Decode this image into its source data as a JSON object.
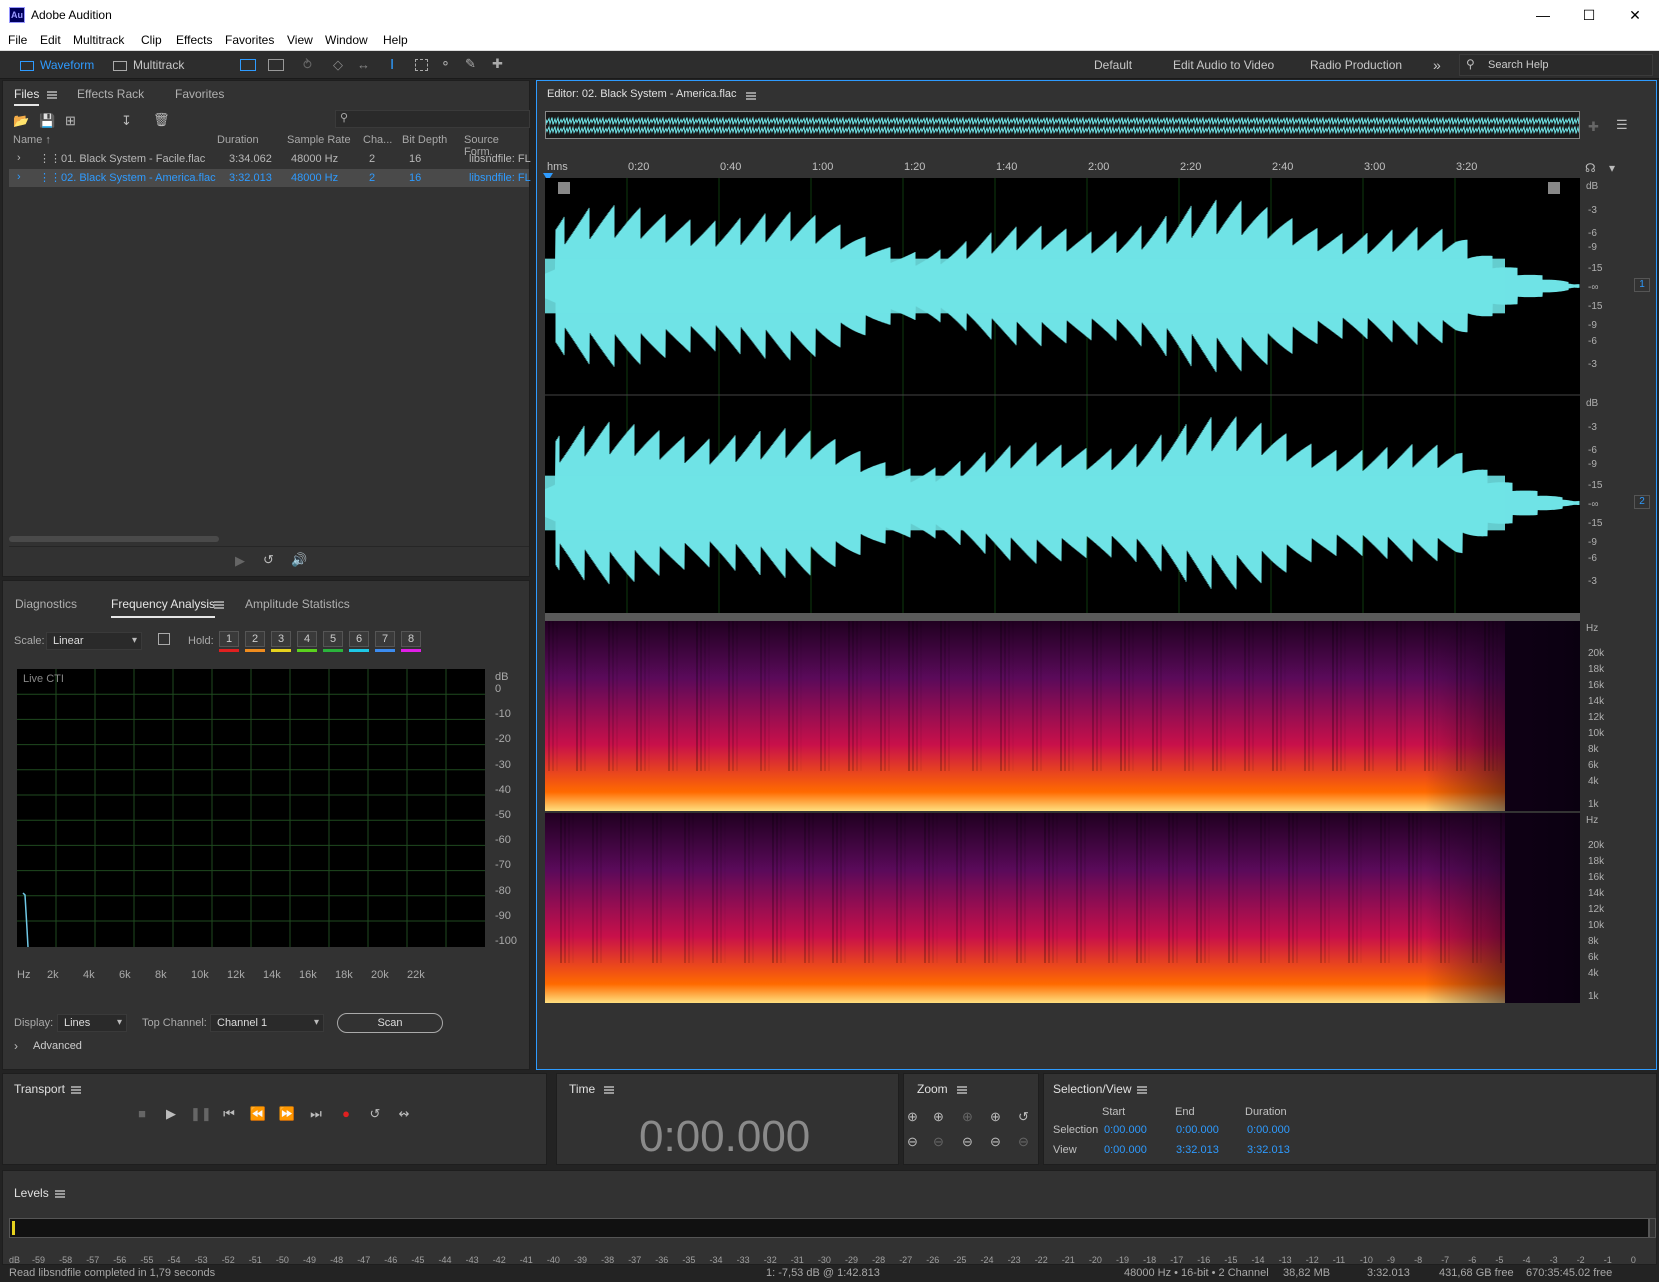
{
  "window": {
    "title": "Adobe Audition",
    "logo": "Au"
  },
  "menu": [
    "File",
    "Edit",
    "Multitrack",
    "Clip",
    "Effects",
    "Favorites",
    "View",
    "Window",
    "Help"
  ],
  "toolbar": {
    "waveform_label": "Waveform",
    "multitrack_label": "Multitrack",
    "workspaces": [
      "Default",
      "Edit Audio to Video",
      "Radio Production"
    ],
    "more": "»",
    "search_placeholder": "Search Help"
  },
  "files_panel": {
    "tabs": [
      "Files",
      "Effects Rack",
      "Favorites"
    ],
    "columns": [
      "Name ↑",
      "Duration",
      "Sample Rate",
      "Cha...",
      "Bit Depth",
      "Source Form."
    ],
    "rows": [
      {
        "name": "01. Black System - Facile.flac",
        "duration": "3:34.062",
        "rate": "48000 Hz",
        "ch": "2",
        "bits": "16",
        "src": "libsndfile: FL",
        "selected": false
      },
      {
        "name": "02. Black System - America.flac",
        "duration": "3:32.013",
        "rate": "48000 Hz",
        "ch": "2",
        "bits": "16",
        "src": "libsndfile: FL",
        "selected": true
      }
    ]
  },
  "freq_panel": {
    "tabs": [
      "Diagnostics",
      "Frequency Analysis",
      "Amplitude Statistics"
    ],
    "scale_label": "Scale:",
    "scale_value": "Linear",
    "hold_label": "Hold:",
    "hold_buttons": [
      "1",
      "2",
      "3",
      "4",
      "5",
      "6",
      "7",
      "8"
    ],
    "hold_colors": [
      "#e02020",
      "#f08c1e",
      "#e6d21e",
      "#5ad21e",
      "#2ab43c",
      "#1ec8e6",
      "#3c8cf0",
      "#e01ee6"
    ],
    "live_label": "Live CTI",
    "db_axis": [
      "dB",
      "0",
      "-10",
      "-20",
      "-30",
      "-40",
      "-50",
      "-60",
      "-70",
      "-80",
      "-90",
      "-100"
    ],
    "hz_axis": [
      "Hz",
      "2k",
      "4k",
      "6k",
      "8k",
      "10k",
      "12k",
      "14k",
      "16k",
      "18k",
      "20k",
      "22k"
    ],
    "display_label": "Display:",
    "display_value": "Lines",
    "top_channel_label": "Top Channel:",
    "top_channel_value": "Channel 1",
    "scan_label": "Scan",
    "advanced_label": "Advanced"
  },
  "editor": {
    "title": "Editor: 02. Black System - America.flac",
    "ruler": [
      "hms",
      "0:20",
      "0:40",
      "1:00",
      "1:20",
      "1:40",
      "2:00",
      "2:20",
      "2:40",
      "3:00",
      "3:20"
    ],
    "db_scale": [
      "dB",
      "-3",
      "-6",
      "-9",
      "-15",
      "-∞",
      "-15",
      "-9",
      "-6",
      "-3"
    ],
    "hz_scale": [
      "Hz",
      "20k",
      "18k",
      "16k",
      "14k",
      "12k",
      "10k",
      "8k",
      "6k",
      "4k",
      "1k"
    ],
    "channels": [
      "1",
      "2"
    ]
  },
  "transport": {
    "title": "Transport"
  },
  "time": {
    "title": "Time",
    "value": "0:00.000"
  },
  "zoom": {
    "title": "Zoom"
  },
  "selection": {
    "title": "Selection/View",
    "headers": [
      "Start",
      "End",
      "Duration"
    ],
    "rows": [
      {
        "label": "Selection",
        "start": "0:00.000",
        "end": "0:00.000",
        "duration": "0:00.000"
      },
      {
        "label": "View",
        "start": "0:00.000",
        "end": "3:32.013",
        "duration": "3:32.013"
      }
    ]
  },
  "levels": {
    "title": "Levels",
    "ticks": [
      "dB",
      "-59",
      "-58",
      "-57",
      "-56",
      "-55",
      "-54",
      "-53",
      "-52",
      "-51",
      "-50",
      "-49",
      "-48",
      "-47",
      "-46",
      "-45",
      "-44",
      "-43",
      "-42",
      "-41",
      "-40",
      "-39",
      "-38",
      "-37",
      "-36",
      "-35",
      "-34",
      "-33",
      "-32",
      "-31",
      "-30",
      "-29",
      "-28",
      "-27",
      "-26",
      "-25",
      "-24",
      "-23",
      "-22",
      "-21",
      "-20",
      "-19",
      "-18",
      "-17",
      "-16",
      "-15",
      "-14",
      "-13",
      "-12",
      "-11",
      "-10",
      "-9",
      "-8",
      "-7",
      "-6",
      "-5",
      "-4",
      "-3",
      "-2",
      "-1",
      "0"
    ]
  },
  "status": {
    "left": "Read libsndfile completed in 1,79 seconds",
    "cursor": "1: -7,53 dB @ 1:42.813",
    "format": "48000 Hz • 16-bit • 2 Channel",
    "size": "38,82 MB",
    "duration": "3:32.013",
    "free": "431,68 GB free",
    "free_time": "670:35:45.02 free"
  },
  "colors": {
    "accent": "#2e9bff",
    "waveform": "#6fe3e6"
  }
}
